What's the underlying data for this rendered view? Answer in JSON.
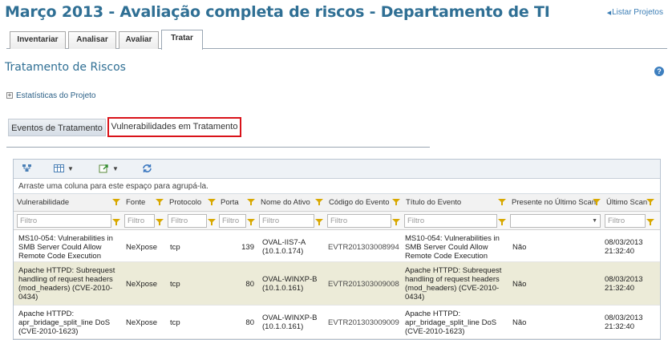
{
  "header": {
    "title": "Março 2013 - Avaliação completa de riscos - Departamento de TI",
    "list_projects": "Listar Projetos"
  },
  "tabs": [
    {
      "label": "Inventariar"
    },
    {
      "label": "Analisar"
    },
    {
      "label": "Avaliar"
    },
    {
      "label": "Tratar",
      "active": true
    }
  ],
  "section_title": "Tratamento de Riscos",
  "help_icon": "?",
  "stats_label": "Estatísticas do Projeto",
  "subtabs": {
    "events": "Eventos de Tratamento",
    "vulnerabilities": "Vulnerabilidades em Tratamento",
    "highlight_color": "#d9131a"
  },
  "grid": {
    "group_hint": "Arraste uma coluna para este espaço para agrupá-la.",
    "columns": [
      "Vulnerabilidade",
      "Fonte",
      "Protocolo",
      "Porta",
      "Nome do Ativo",
      "Código do Evento",
      "Título do Evento",
      "Presente no Último Scan",
      "Último Scan"
    ],
    "filter_placeholder": "Filtro",
    "rows": [
      {
        "vuln": [
          "MS10-054: Vulnerabilities in",
          "SMB Server Could Allow",
          "Remote Code Execution"
        ],
        "fonte": "NeXpose",
        "protocolo": "tcp",
        "porta": "139",
        "ativo": [
          "OVAL-IIS7-A",
          "(10.1.0.174)"
        ],
        "codigo": "EVTR201303008994",
        "titulo": [
          "MS10-054: Vulnerabilities in",
          "SMB Server Could Allow",
          "Remote Code Execution"
        ],
        "presente": "Não",
        "scan": [
          "08/03/2013",
          "21:32:40"
        ]
      },
      {
        "vuln": [
          "Apache HTTPD: Subrequest",
          "handling of request headers",
          "(mod_headers) (CVE-2010-",
          "0434)"
        ],
        "fonte": "NeXpose",
        "protocolo": "tcp",
        "porta": "80",
        "ativo": [
          "OVAL-WINXP-B",
          "(10.1.0.161)"
        ],
        "codigo": "EVTR201303009008",
        "titulo": [
          "Apache HTTPD: Subrequest",
          "handling of request headers",
          "(mod_headers) (CVE-2010-",
          "0434)"
        ],
        "presente": "Não",
        "scan": [
          "08/03/2013",
          "21:32:40"
        ]
      },
      {
        "vuln": [
          "Apache HTTPD:",
          "apr_bridage_split_line DoS",
          "(CVE-2010-1623)"
        ],
        "fonte": "NeXpose",
        "protocolo": "tcp",
        "porta": "80",
        "ativo": [
          "OVAL-WINXP-B",
          "(10.1.0.161)"
        ],
        "codigo": "EVTR201303009009",
        "titulo": [
          "Apache HTTPD:",
          "apr_bridage_split_line DoS",
          "(CVE-2010-1623)"
        ],
        "presente": "Não",
        "scan": [
          "08/03/2013",
          "21:32:40"
        ]
      }
    ]
  }
}
